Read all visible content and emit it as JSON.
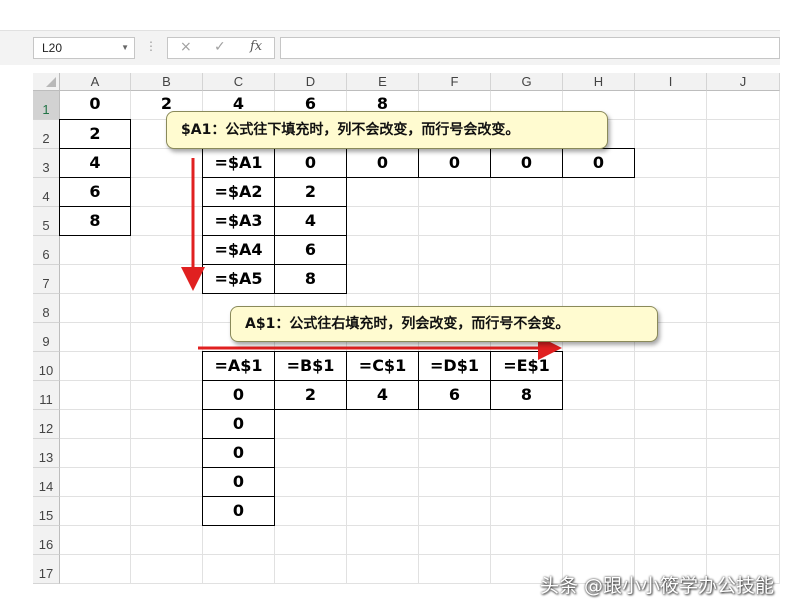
{
  "formula_bar": {
    "name_box": "L20",
    "cancel_icon": "×",
    "enter_icon": "✓",
    "function_icon": "fx",
    "formula": ""
  },
  "columns": [
    "A",
    "B",
    "C",
    "D",
    "E",
    "F",
    "G",
    "H",
    "I",
    "J"
  ],
  "rows": [
    "1",
    "2",
    "3",
    "4",
    "5",
    "6",
    "7",
    "8",
    "9",
    "10",
    "11",
    "12",
    "13",
    "14",
    "15",
    "16",
    "17"
  ],
  "selected_row": "1",
  "cells": {
    "A1": "0",
    "B1": "2",
    "C1": "4",
    "D1": "6",
    "E1": "8",
    "A2": "2",
    "A3": "4",
    "A4": "6",
    "A5": "8",
    "C3": "=$A1",
    "C4": "=$A2",
    "C5": "=$A3",
    "C6": "=$A4",
    "C7": "=$A5",
    "D3": "0",
    "D4": "2",
    "D5": "4",
    "D6": "6",
    "D7": "8",
    "E3": "0",
    "F3": "0",
    "G3": "0",
    "H3": "0",
    "C10": "=A$1",
    "D10": "=B$1",
    "E10": "=C$1",
    "F10": "=D$1",
    "G10": "=E$1",
    "C11": "0",
    "D11": "2",
    "E11": "4",
    "F11": "6",
    "G11": "8",
    "C12": "0",
    "C13": "0",
    "C14": "0",
    "C15": "0"
  },
  "callouts": {
    "down": "$A1：公式往下填充时，列不会改变，而行号会改变。",
    "right": "A$1：公式往右填充时，列会改变，而行号不会变。"
  },
  "colors": {
    "arrow": "#e02020",
    "callout_bg": "#fffbd0",
    "selected_header_text": "#217346"
  },
  "watermark": "头条 @跟小小筱学办公技能"
}
